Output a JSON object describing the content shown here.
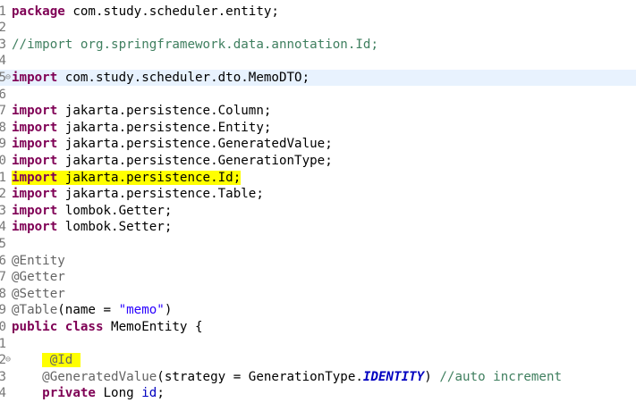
{
  "editor": {
    "language": "java",
    "colors": {
      "keyword": "#7f0055",
      "comment": "#3f7f5f",
      "annotation": "#646464",
      "string": "#2a00ff",
      "field": "#0000c0",
      "highlight": "#ffff00",
      "current_line": "#e8f2fe"
    },
    "lines": [
      {
        "n": "1",
        "tokens": [
          {
            "t": "package",
            "c": "kw"
          },
          {
            "t": " com.study.scheduler.entity;"
          }
        ]
      },
      {
        "n": "2",
        "tokens": []
      },
      {
        "n": "3",
        "tokens": [
          {
            "t": "//import org.springframework.data.annotation.Id;",
            "c": "cm"
          }
        ]
      },
      {
        "n": "4",
        "tokens": []
      },
      {
        "n": "5",
        "fold": true,
        "current": true,
        "tokens": [
          {
            "t": "import",
            "c": "kw"
          },
          {
            "t": " com.study.scheduler.dto.MemoDTO;"
          }
        ]
      },
      {
        "n": "6",
        "tokens": []
      },
      {
        "n": "7",
        "tokens": [
          {
            "t": "import",
            "c": "kw"
          },
          {
            "t": " jakarta.persistence.Column;"
          }
        ]
      },
      {
        "n": "8",
        "tokens": [
          {
            "t": "import",
            "c": "kw"
          },
          {
            "t": " jakarta.persistence.Entity;"
          }
        ]
      },
      {
        "n": "9",
        "tokens": [
          {
            "t": "import",
            "c": "kw"
          },
          {
            "t": " jakarta.persistence.GeneratedValue;"
          }
        ]
      },
      {
        "n": "0",
        "tokens": [
          {
            "t": "import",
            "c": "kw"
          },
          {
            "t": " jakarta.persistence.GenerationType;"
          }
        ]
      },
      {
        "n": "1",
        "tokens": [
          {
            "t": "import",
            "c": "kw hl"
          },
          {
            "t": " jakarta.persistence.Id;",
            "c": "hl"
          }
        ]
      },
      {
        "n": "2",
        "tokens": [
          {
            "t": "import",
            "c": "kw"
          },
          {
            "t": " jakarta.persistence.Table;"
          }
        ]
      },
      {
        "n": "3",
        "tokens": [
          {
            "t": "import",
            "c": "kw"
          },
          {
            "t": " lombok.Getter;"
          }
        ]
      },
      {
        "n": "4",
        "tokens": [
          {
            "t": "import",
            "c": "kw"
          },
          {
            "t": " lombok.Setter;"
          }
        ]
      },
      {
        "n": "5",
        "tokens": []
      },
      {
        "n": "6",
        "tokens": [
          {
            "t": "@Entity",
            "c": "an"
          }
        ]
      },
      {
        "n": "7",
        "tokens": [
          {
            "t": "@Getter",
            "c": "an"
          }
        ]
      },
      {
        "n": "8",
        "tokens": [
          {
            "t": "@Setter",
            "c": "an"
          }
        ]
      },
      {
        "n": "9",
        "tokens": [
          {
            "t": "@Table",
            "c": "an"
          },
          {
            "t": "(name = "
          },
          {
            "t": "\"memo\"",
            "c": "str"
          },
          {
            "t": ")"
          }
        ]
      },
      {
        "n": "0",
        "tokens": [
          {
            "t": "public",
            "c": "kw"
          },
          {
            "t": " "
          },
          {
            "t": "class",
            "c": "kw"
          },
          {
            "t": " MemoEntity {"
          }
        ]
      },
      {
        "n": "1",
        "tokens": []
      },
      {
        "n": "2",
        "fold": true,
        "tokens": [
          {
            "t": "    "
          },
          {
            "t": " @Id ",
            "c": "an hl"
          }
        ]
      },
      {
        "n": "3",
        "tokens": [
          {
            "t": "    "
          },
          {
            "t": "@GeneratedValue",
            "c": "an"
          },
          {
            "t": "(strategy = GenerationType."
          },
          {
            "t": "IDENTITY",
            "c": "cst"
          },
          {
            "t": ") "
          },
          {
            "t": "//auto increment",
            "c": "cm"
          }
        ]
      },
      {
        "n": "4",
        "tokens": [
          {
            "t": "    "
          },
          {
            "t": "private",
            "c": "kw"
          },
          {
            "t": " Long "
          },
          {
            "t": "id",
            "c": "fld"
          },
          {
            "t": ";"
          }
        ]
      }
    ]
  }
}
